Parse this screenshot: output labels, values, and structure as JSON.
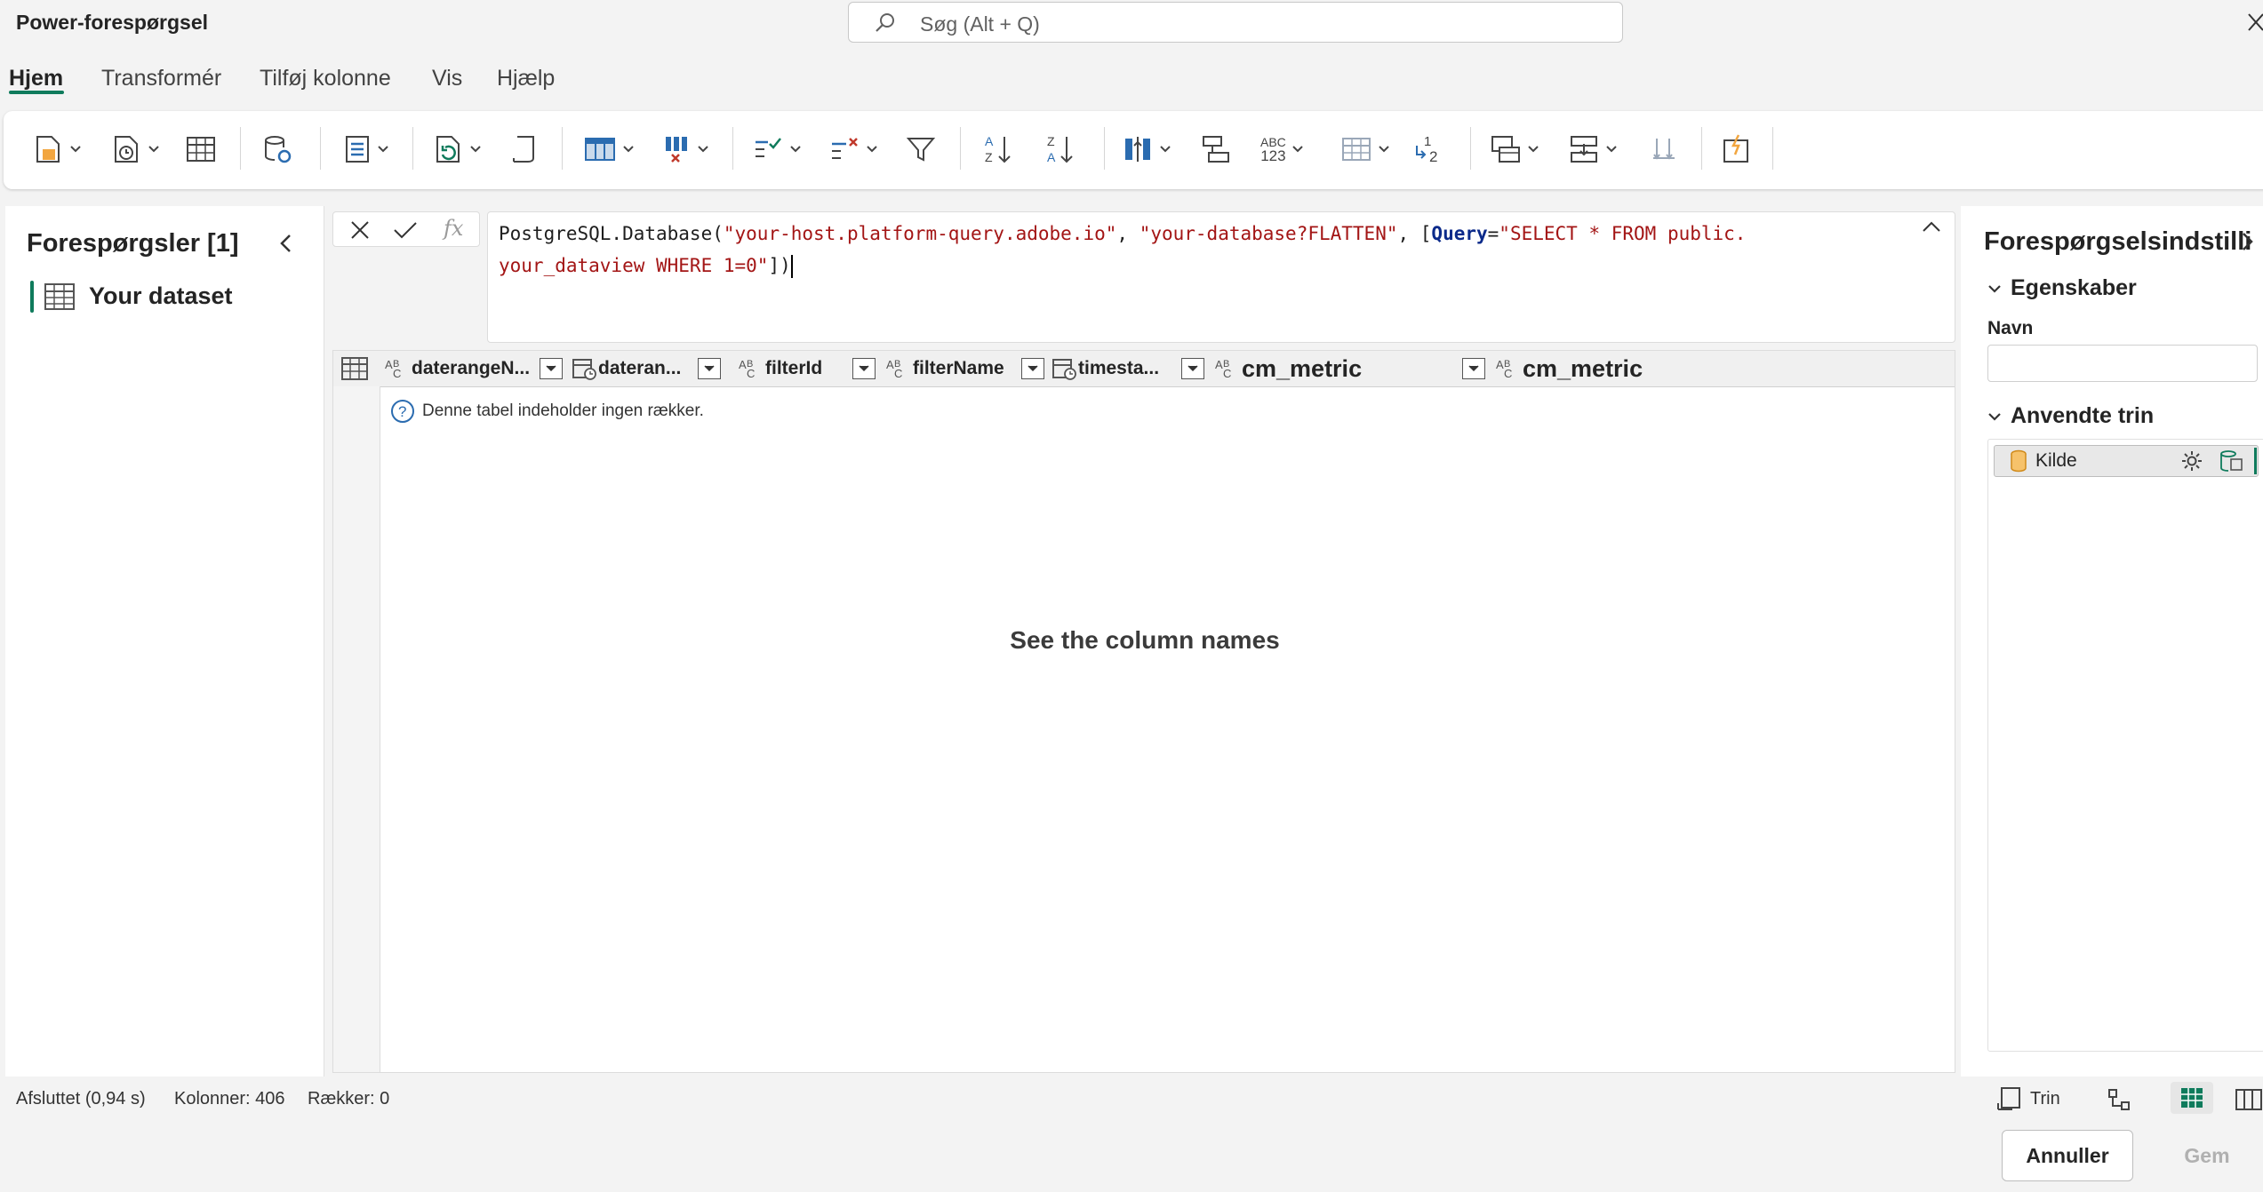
{
  "app": {
    "title": "Power-forespørgsel"
  },
  "search": {
    "placeholder": "Søg (Alt + Q)"
  },
  "tabs": [
    {
      "label": "Hjem",
      "active": true
    },
    {
      "label": "Transformér"
    },
    {
      "label": "Tilføj kolonne"
    },
    {
      "label": "Vis"
    },
    {
      "label": "Hjælp"
    }
  ],
  "ribbon": {
    "icons": [
      "new-query-icon",
      "recent-sources-icon",
      "enter-data-icon",
      "datasource-settings-icon",
      "manage-parameters-icon",
      "refresh-icon",
      "properties-icon",
      "choose-columns-icon",
      "remove-columns-icon",
      "keep-rows-icon",
      "remove-rows-icon",
      "filter-icon",
      "sort-ascending-icon",
      "sort-descending-icon",
      "split-column-icon",
      "group-by-icon",
      "data-type-icon",
      "use-first-row-icon",
      "replace-values-icon",
      "merge-queries-icon",
      "append-queries-icon",
      "combine-files-icon",
      "insights-icon"
    ],
    "data_type_label_top": "ABC",
    "data_type_label_bottom": "123"
  },
  "queries_panel": {
    "title": "Forespørgsler [1]",
    "items": [
      {
        "label": "Your dataset"
      }
    ]
  },
  "formula_bar": {
    "fx": "fx",
    "part1": "PostgreSQL.Database(",
    "arg1": "\"your-host.platform-query.adobe.io\"",
    "comma1": ", ",
    "arg2": "\"your-database?FLATTEN\"",
    "comma2": ", [",
    "kw": "Query",
    "eq": "=",
    "arg3a": "\"SELECT * FROM public.",
    "arg3b": "your_dataview WHERE 1=0\"",
    "close": "])"
  },
  "grid": {
    "columns": [
      {
        "name": "daterangeN...",
        "type": "text"
      },
      {
        "name": "dateran...",
        "type": "datetime"
      },
      {
        "name": "filterId",
        "type": "text"
      },
      {
        "name": "filterName",
        "type": "text"
      },
      {
        "name": "timesta...",
        "type": "datetime"
      },
      {
        "name": "cm_metric",
        "type": "text"
      },
      {
        "name": "cm_metric",
        "type": "text"
      }
    ],
    "type_glyphs": {
      "text_top": "A",
      "text_bottom": "B",
      "text_small": "C"
    },
    "empty_message": "Denne tabel indeholder ingen rækker.",
    "overlay_text": "See the column names"
  },
  "settings_panel": {
    "title": "Forespørgselsindstillinger",
    "properties_label": "Egenskaber",
    "name_label": "Navn",
    "name_value": "",
    "applied_steps_label": "Anvendte trin",
    "steps": [
      {
        "label": "Kilde"
      }
    ]
  },
  "status_bar": {
    "completed": "Afsluttet (0,94 s)",
    "columns": "Kolonner: 406",
    "rows": "Rækker: 0",
    "steps_label": "Trin"
  },
  "footer": {
    "cancel": "Annuller",
    "save": "Gem"
  },
  "colors": {
    "accent": "#0f7b5c",
    "string": "#a31515",
    "keyword": "#0b2a8a"
  }
}
